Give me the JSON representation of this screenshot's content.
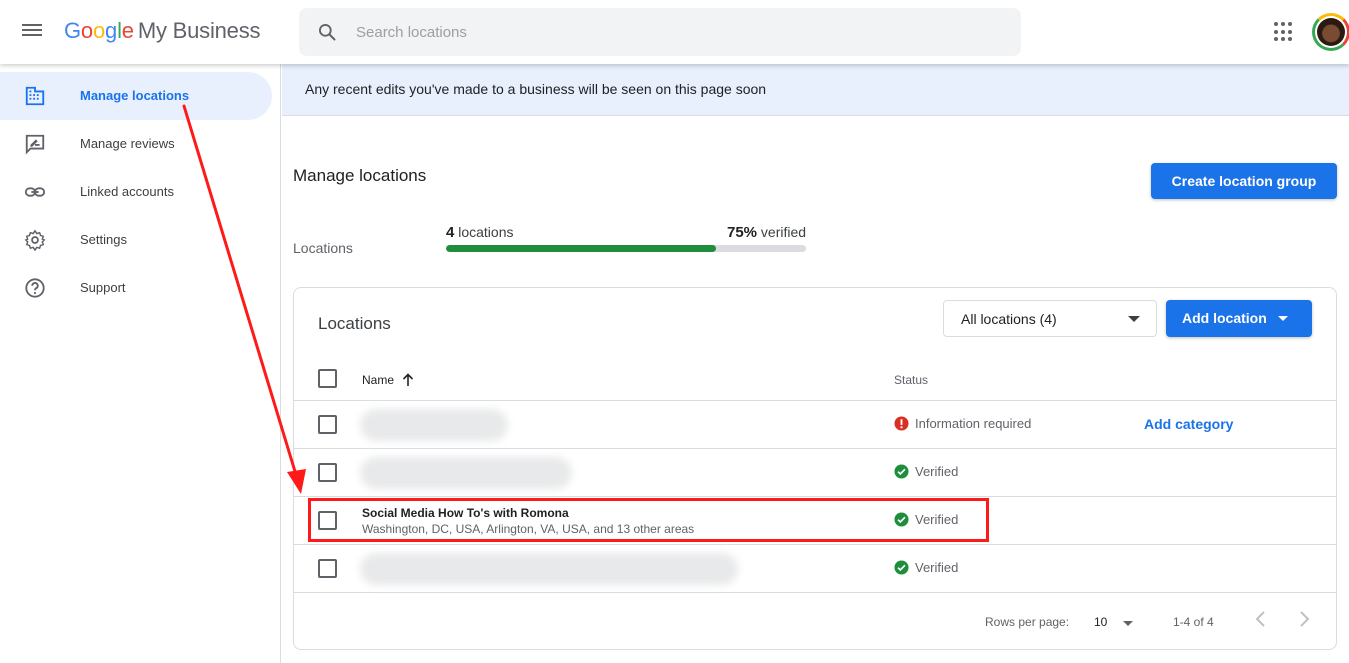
{
  "header": {
    "logo": {
      "g1": "G",
      "o1": "o",
      "o2": "o",
      "g2": "g",
      "l": "l",
      "e": "e",
      "product": "My Business"
    },
    "search_placeholder": "Search locations"
  },
  "sidebar": {
    "items": [
      {
        "label": "Manage locations",
        "icon": "building-icon",
        "active": true
      },
      {
        "label": "Manage reviews",
        "icon": "reviews-icon",
        "active": false
      },
      {
        "label": "Linked accounts",
        "icon": "link-icon",
        "active": false
      },
      {
        "label": "Settings",
        "icon": "gear-icon",
        "active": false
      },
      {
        "label": "Support",
        "icon": "help-icon",
        "active": false
      }
    ]
  },
  "banner": {
    "text": "Any recent edits you've made to a business will be seen on this page soon"
  },
  "main": {
    "title": "Manage locations",
    "create_group_label": "Create location group",
    "summary": {
      "label": "Locations",
      "count_number": "4",
      "count_text": "locations",
      "verified_percent": "75%",
      "verified_text": "verified",
      "verified_fraction": 0.75
    }
  },
  "card": {
    "title": "Locations",
    "filter_value": "All locations (4)",
    "add_location_label": "Add location",
    "columns": {
      "name": "Name",
      "status": "Status"
    },
    "rows": [
      {
        "name": "",
        "address": "",
        "status": "Information required",
        "status_type": "error",
        "action": "Add category"
      },
      {
        "name": "",
        "address": "",
        "status": "Verified",
        "status_type": "verified",
        "action": ""
      },
      {
        "name": "Social Media How To's with Romona",
        "address": "Washington, DC, USA, Arlington, VA, USA, and 13 other areas",
        "status": "Verified",
        "status_type": "verified",
        "action": ""
      },
      {
        "name": "",
        "address": "",
        "status": "Verified",
        "status_type": "verified",
        "action": ""
      }
    ],
    "pagination": {
      "rows_per_page_label": "Rows per page:",
      "rows_per_page": "10",
      "range": "1-4 of 4"
    }
  },
  "colors": {
    "accent": "#1a73e8",
    "verified": "#1e8e3e",
    "error": "#d93025",
    "annotation": "#ff1a1a"
  }
}
